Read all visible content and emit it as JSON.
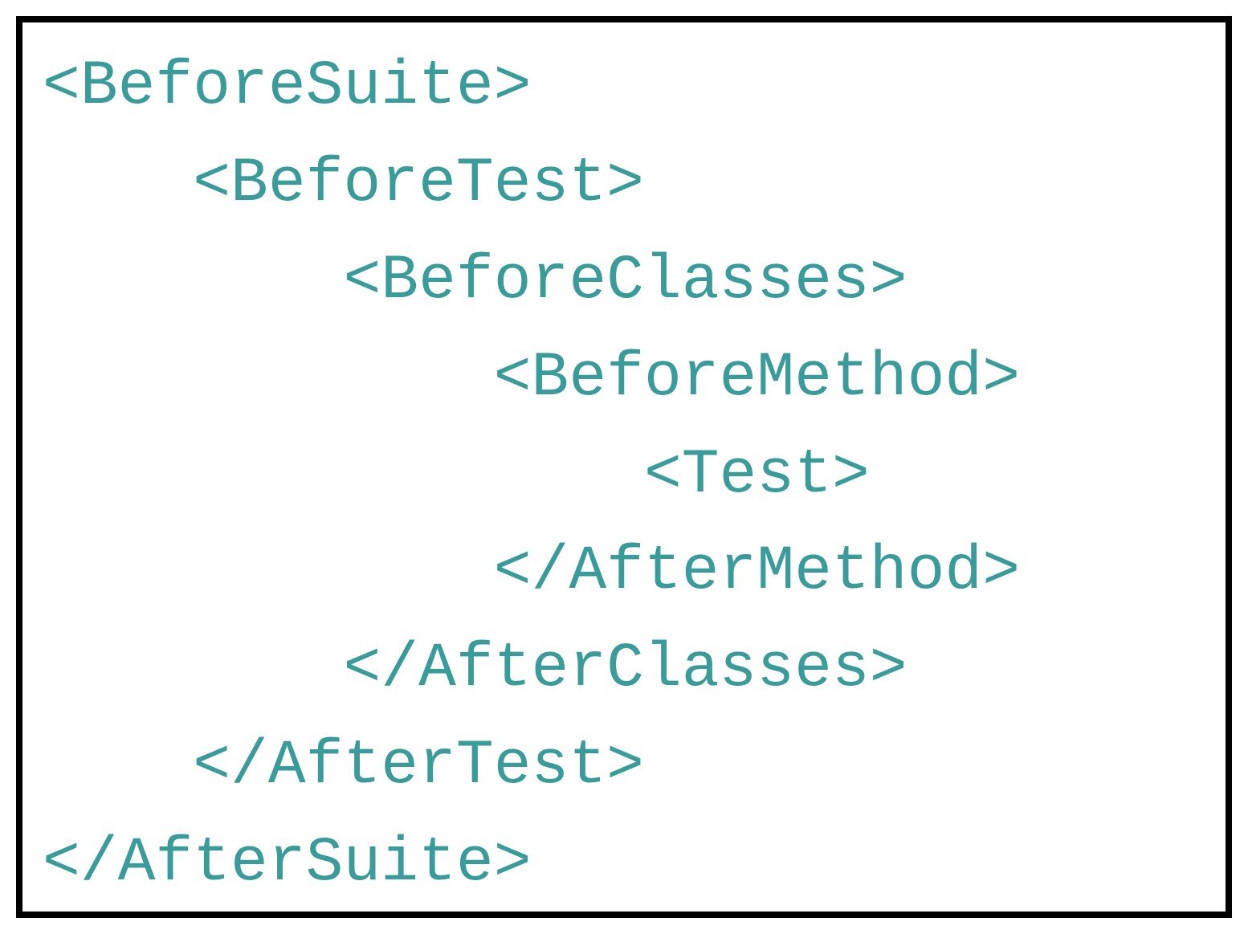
{
  "code": {
    "lines": [
      {
        "indent": 0,
        "open": "<",
        "name": "BeforeSuite",
        "close": ">"
      },
      {
        "indent": 1,
        "open": "<",
        "name": "BeforeTest",
        "close": ">"
      },
      {
        "indent": 2,
        "open": "<",
        "name": "BeforeClasses",
        "close": ">"
      },
      {
        "indent": 3,
        "open": "<",
        "name": "BeforeMethod",
        "close": ">"
      },
      {
        "indent": 4,
        "open": "<",
        "name": "Test",
        "close": ">"
      },
      {
        "indent": 3,
        "open": "</",
        "name": "AfterMethod",
        "close": ">"
      },
      {
        "indent": 2,
        "open": "</",
        "name": "AfterClasses",
        "close": ">"
      },
      {
        "indent": 1,
        "open": "</",
        "name": "AfterTest",
        "close": ">"
      },
      {
        "indent": 0,
        "open": "</",
        "name": "AfterSuite",
        "close": ">"
      }
    ]
  },
  "indentUnit": "    "
}
